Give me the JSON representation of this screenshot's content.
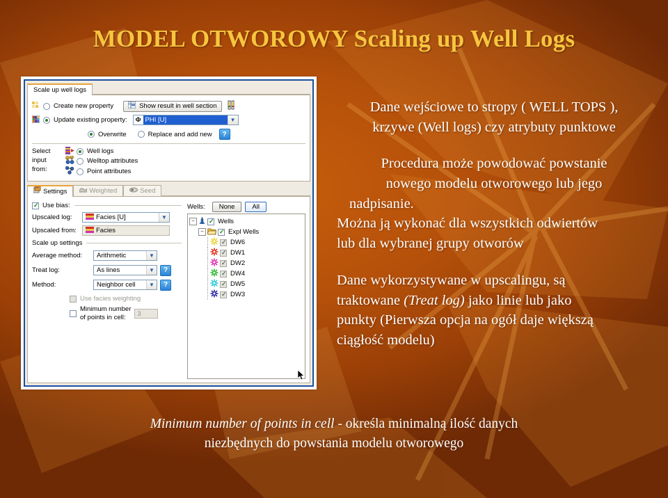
{
  "slide": {
    "title": "MODEL OTWOROWY Scaling up Well Logs",
    "title_color": "#F7C53F",
    "background_colors": [
      "#5A2204",
      "#BD560B",
      "#4E1C03"
    ],
    "text_color": "#FFFFFF"
  },
  "body_text": {
    "paragraph1_line1": "Dane wejściowe to stropy ( WELL TOPS ),",
    "paragraph1_line2": "krzywe (Well logs) czy atrybuty punktowe",
    "paragraph2_line1": "Procedura może powodować powstanie",
    "paragraph2_line2": "nowego modelu otworowego lub jego",
    "paragraph2_line3": "nadpisanie.",
    "paragraph3_line1": "Można ją wykonać dla wszystkich odwiertów",
    "paragraph3_line2": "lub dla wybranej grupy otworów",
    "paragraph4_line1": "Dane wykorzystywane w upscalingu, są",
    "paragraph4_line2_pre": "traktowane ",
    "paragraph4_line2_italic": "(Treat log)",
    "paragraph4_line2_post": " jako linie lub jako",
    "paragraph4_line3": "punkty (Pierwsza opcja na ogół daje większą",
    "paragraph4_line4": "ciągłość modelu)"
  },
  "caption": {
    "italic_part": "Minimum number of points in cell",
    "rest_line1": " - określa minimalną ilość danych",
    "line2": "niezbędnych do powstania modelu otworowego"
  },
  "dialog": {
    "top_tab": "Scale up well logs",
    "create_new_property": "Create new property",
    "update_existing_property": "Update existing property:",
    "show_result_button": "Show result in well section",
    "property_value": "PHI [U]",
    "overwrite": "Overwrite",
    "replace_and_add_new": "Replace and add new",
    "help_glyph": "?",
    "select_input_from_line1": "Select",
    "select_input_from_line2": "input",
    "select_input_from_line3": "from:",
    "input_options": [
      "Well logs",
      "Welltop attributes",
      "Point attributes"
    ],
    "tabs": [
      {
        "label": "Settings",
        "active": true
      },
      {
        "label": "Weighted",
        "active": false
      },
      {
        "label": "Seed",
        "active": false
      }
    ],
    "use_bias": "Use bias:",
    "upscaled_log_label": "Upscaled log:",
    "upscaled_log_value": "Facies [U]",
    "upscaled_from_label": "Upscaled from:",
    "upscaled_from_value": "Facies",
    "scale_up_settings": "Scale up settings",
    "average_method_label": "Average method:",
    "average_method_value": "Arithmetic",
    "treat_log_label": "Treat log:",
    "treat_log_value": "As lines",
    "method_label": "Method:",
    "method_value": "Neighbor cell",
    "use_facies_weighting": "Use facies weighting",
    "minimum_number_line1": "Minimum number",
    "minimum_number_line2": "of points in cell:",
    "minimum_number_value": "3",
    "wells_label": "Wells:",
    "wells_none_button": "None",
    "wells_all_button": "All",
    "tree": {
      "root": "Wells",
      "folder": "Expl Wells",
      "wells": [
        {
          "name": "DW6",
          "color": "#E8D53B"
        },
        {
          "name": "DW1",
          "color": "#E03020"
        },
        {
          "name": "DW2",
          "color": "#E030B0"
        },
        {
          "name": "DW4",
          "color": "#2BB82B"
        },
        {
          "name": "DW5",
          "color": "#28C8D8"
        },
        {
          "name": "DW3",
          "color": "#2A2A9C"
        }
      ]
    }
  }
}
